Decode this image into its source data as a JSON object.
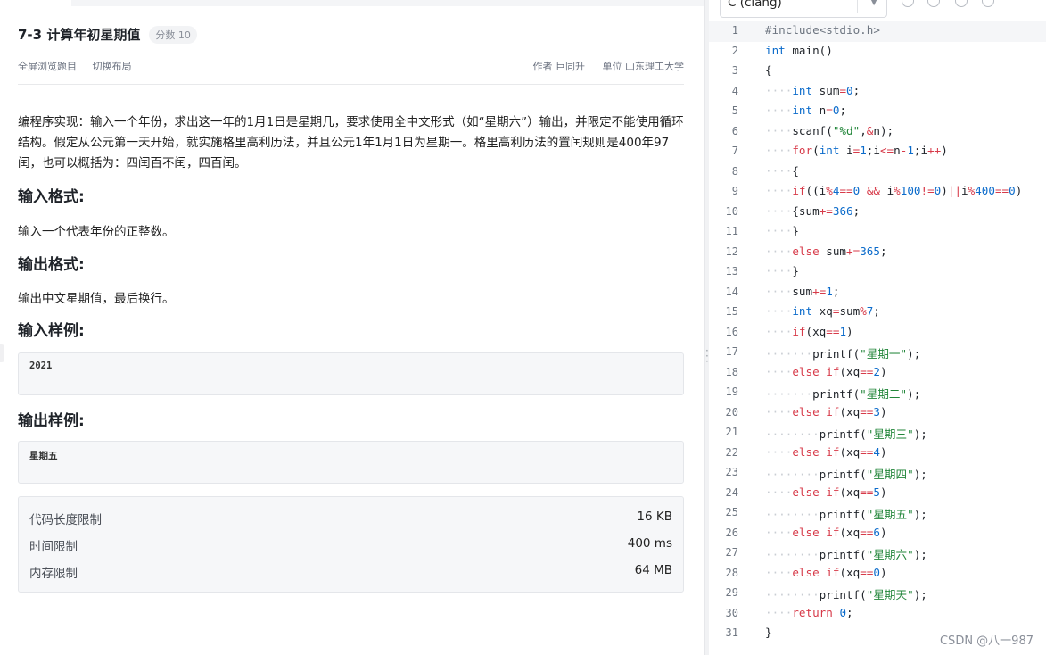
{
  "problem": {
    "title": "7-3 计算年初星期值",
    "score": "分数 10",
    "actions": [
      "全屏浏览题目",
      "切换布局"
    ],
    "author": "作者 巨同升",
    "unit": "单位 山东理工大学",
    "description": "编程序实现：输入一个年份，求出这一年的1月1日是星期几，要求使用全中文形式（如“星期六”）输出，并限定不能使用循环结构。假定从公元第一天开始，就实施格里高利历法，并且公元1年1月1日为星期一。格里高利历法的置闰规则是400年97闰，也可以概括为：四闰百不闰，四百闰。",
    "input_heading": "输入格式:",
    "input_text": "输入一个代表年份的正整数。",
    "output_heading": "输出格式:",
    "output_text": "输出中文星期值，最后换行。",
    "sample_in_heading": "输入样例:",
    "sample_in": "2021",
    "sample_out_heading": "输出样例:",
    "sample_out": "星期五",
    "limits": [
      {
        "label": "代码长度限制",
        "value": "16 KB"
      },
      {
        "label": "时间限制",
        "value": "400 ms"
      },
      {
        "label": "内存限制",
        "value": "64 MB"
      }
    ]
  },
  "editor": {
    "language": "C (clang)",
    "icons": [
      "info-icon",
      "history-icon",
      "settings-icon",
      "help-icon"
    ],
    "lines": [
      "#include<stdio.h>",
      "int main()",
      "{",
      "    int sum=0;",
      "    int n=0;",
      "    scanf(\"%d\",&n);",
      "    for(int i=1;i<=n-1;i++)",
      "    {",
      "    if((i%4==0 && i%100!=0)||i%400==0)",
      "    {sum+=366;",
      "    }",
      "    else sum+=365;",
      "    }",
      "    sum+=1;",
      "    int xq=sum%7;",
      "    if(xq==1)",
      "       printf(\"星期一\");",
      "    else if(xq==2)",
      "       printf(\"星期二\");",
      "    else if(xq==3)",
      "        printf(\"星期三\");",
      "    else if(xq==4)",
      "        printf(\"星期四\");",
      "    else if(xq==5)",
      "        printf(\"星期五\");",
      "    else if(xq==6)",
      "        printf(\"星期六\");",
      "    else if(xq==0)",
      "        printf(\"星期天\");",
      "    return 0;",
      "}"
    ]
  },
  "watermark": "CSDN @八一987"
}
